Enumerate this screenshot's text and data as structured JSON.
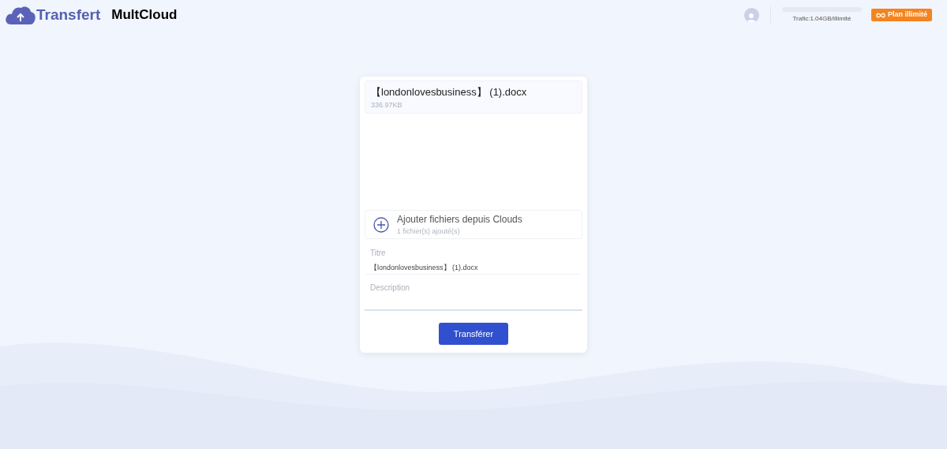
{
  "header": {
    "logo_text": "Transfert",
    "app_name": "MultCloud",
    "traffic": {
      "level": 0,
      "label": "Trafic:1.04GB/Illimité"
    },
    "plan_button": "Plan illimité"
  },
  "file": {
    "name": "【londonlovesbusiness】 (1).docx",
    "size": "336.97KB"
  },
  "add_files": {
    "title": "Ajouter fichiers depuis Clouds",
    "count": "1 fichier(s) ajouté(s)"
  },
  "title_field": {
    "label": "Titre",
    "value": "【londonlovesbusiness】 (1).docx"
  },
  "description_field": {
    "placeholder": "Description"
  },
  "submit_button": "Transférer"
}
